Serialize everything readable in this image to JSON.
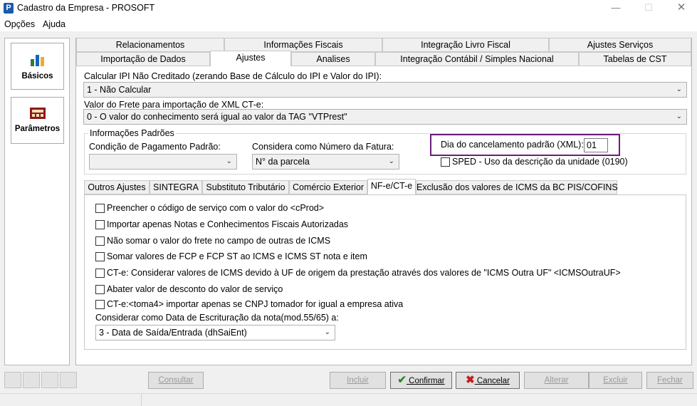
{
  "window": {
    "title": "Cadastro da Empresa - PROSOFT",
    "app_icon": "P"
  },
  "menu": [
    "Opções",
    "Ajuda"
  ],
  "sidebar": [
    {
      "label": "Básicos",
      "icon": "bar-chart-icon"
    },
    {
      "label": "Parâmetros",
      "icon": "calculator-icon"
    }
  ],
  "tabs_row1": [
    "Relacionamentos",
    "Informações Fiscais",
    "Integração Livro Fiscal",
    "Ajustes Serviços"
  ],
  "tabs_row2": [
    "Importação de Dados",
    "Ajustes",
    "Analises",
    "Integração Contábil / Simples Nacional",
    "Tabelas de CST"
  ],
  "active_tab": "Ajustes",
  "ipi": {
    "label": "Calcular IPI Não Creditado (zerando Base de Cálculo do IPI e Valor do IPI):",
    "value": "1 - Não Calcular"
  },
  "frete": {
    "label": "Valor do Frete para importação de XML CT-e:",
    "value": "0 - O valor do conhecimento será igual ao valor da TAG \"VTPrest\""
  },
  "info": {
    "title": "Informações Padrões",
    "condicao_label": "Condição de Pagamento Padrão:",
    "condicao_value": "",
    "fatura_label": "Considera como Número da Fatura:",
    "fatura_value": "N° da parcela",
    "cancel_label": "Dia do cancelamento padrão (XML):",
    "cancel_value": "01",
    "sped_label": "SPED - Uso da descrição da unidade (0190)"
  },
  "subtabs": [
    "Outros Ajustes",
    "SINTEGRA",
    "Substituto Tributário",
    "Comércio Exterior",
    "NF-e/CT-e",
    "Exclusão dos valores de ICMS da BC PIS/COFINS"
  ],
  "active_subtab": "NF-e/CT-e",
  "checkboxes": [
    "Preencher o código de serviço com o valor do <cProd>",
    "Importar apenas Notas e Conhecimentos Fiscais Autorizadas",
    "Não somar o valor do frete no campo de outras de ICMS",
    "Somar valores de FCP e FCP ST ao ICMS e ICMS ST nota e item",
    "CT-e: Considerar valores de ICMS devido à UF de origem da prestação através dos valores de \"ICMS Outra UF\" <ICMSOutraUF>",
    "Abater valor de desconto do valor de serviço",
    "CT-e:<toma4> importar apenas se CNPJ tomador for igual a empresa ativa"
  ],
  "escrituracao": {
    "label": "Considerar como Data de Escrituração da nota(mod.55/65) a:",
    "value": "3 -  Data de Saída/Entrada (dhSaiEnt)"
  },
  "buttons": {
    "consultar": "Consultar",
    "incluir": "Incluir",
    "confirmar": "Confirmar",
    "cancelar": "Cancelar",
    "alterar": "Alterar",
    "excluir": "Excluir",
    "fechar": "Fechar"
  },
  "colors": {
    "highlight": "#6b1c7d",
    "confirm_check": "#2a8a2a",
    "cancel_x": "#c02020"
  }
}
